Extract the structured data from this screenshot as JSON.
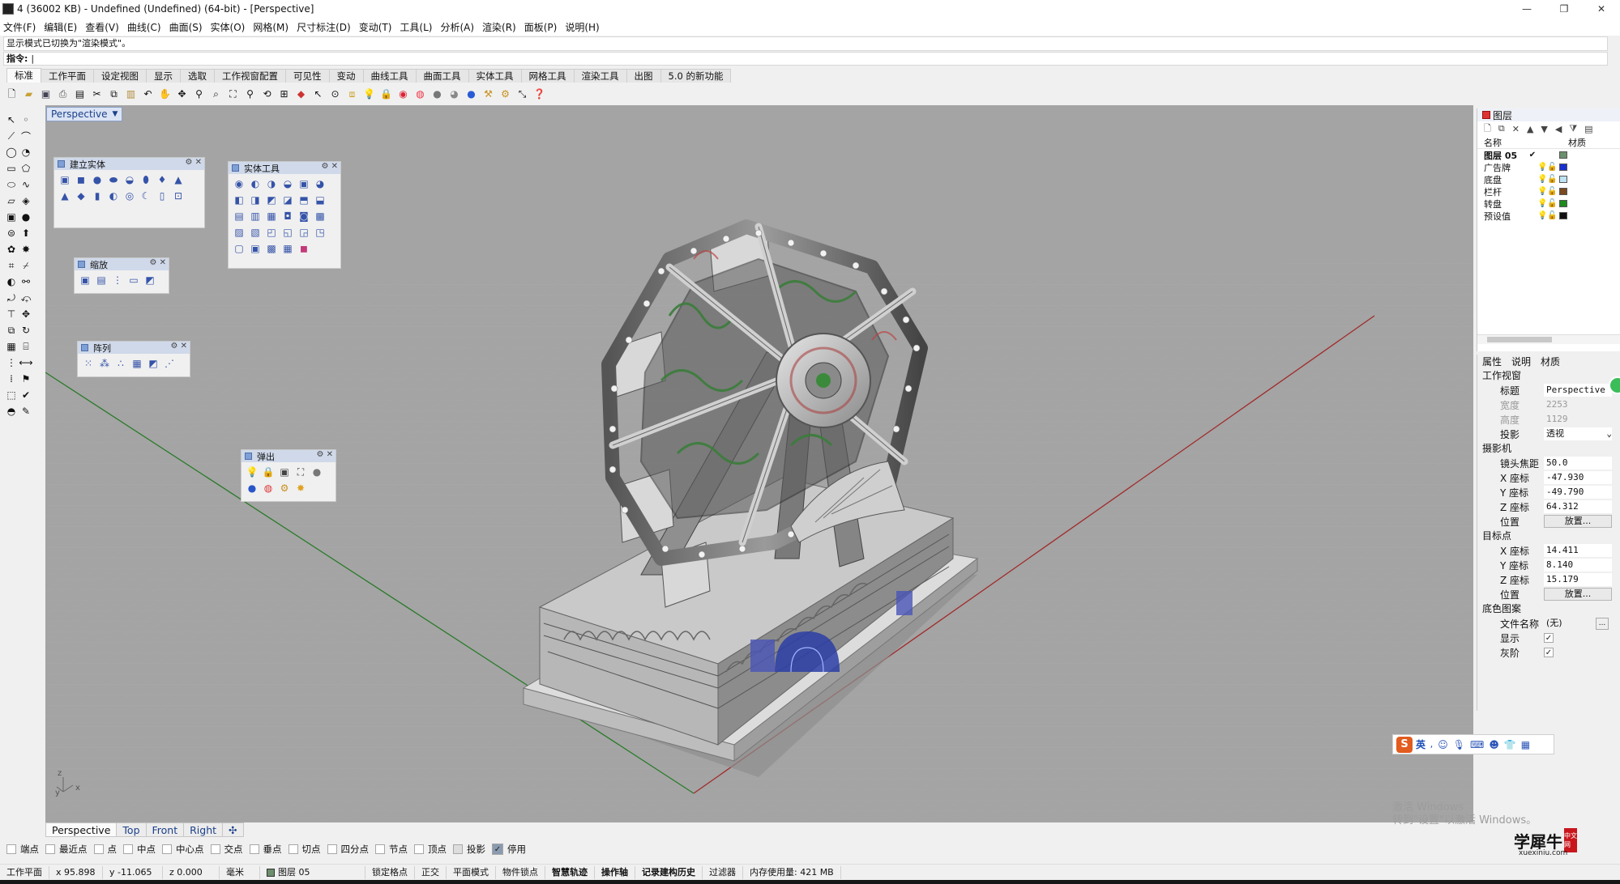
{
  "window": {
    "title": "4 (36002 KB) - Undefined (Undefined) (64-bit) - [Perspective]",
    "min": "—",
    "max": "❐",
    "close": "✕"
  },
  "menu": [
    "文件(F)",
    "编辑(E)",
    "查看(V)",
    "曲线(C)",
    "曲面(S)",
    "实体(O)",
    "网格(M)",
    "尺寸标注(D)",
    "变动(T)",
    "工具(L)",
    "分析(A)",
    "渲染(R)",
    "面板(P)",
    "说明(H)"
  ],
  "command": {
    "history": "显示模式已切换为\"渲染模式\"。",
    "prompt_label": "指令:",
    "prompt_value": "|"
  },
  "toolbar_tabs": [
    "标准",
    "工作平面",
    "设定视图",
    "显示",
    "选取",
    "工作视窗配置",
    "可见性",
    "变动",
    "曲线工具",
    "曲面工具",
    "实体工具",
    "网格工具",
    "渲染工具",
    "出图",
    "5.0 的新功能"
  ],
  "viewport": {
    "title": "Perspective",
    "axis_labels": {
      "x": "x",
      "y": "y",
      "z": "z"
    }
  },
  "palettes": {
    "solid_create": "建立实体",
    "solid_tools": "实体工具",
    "zoom": "缩放",
    "array": "阵列",
    "popup": "弹出"
  },
  "viewport_tabs": [
    "Perspective",
    "Top",
    "Front",
    "Right"
  ],
  "viewport_tab_add": "✣",
  "osnaps": [
    {
      "label": "端点",
      "checked": false
    },
    {
      "label": "最近点",
      "checked": false
    },
    {
      "label": "点",
      "checked": false
    },
    {
      "label": "中点",
      "checked": false
    },
    {
      "label": "中心点",
      "checked": false
    },
    {
      "label": "交点",
      "checked": false
    },
    {
      "label": "垂点",
      "checked": false
    },
    {
      "label": "切点",
      "checked": false
    },
    {
      "label": "四分点",
      "checked": false
    },
    {
      "label": "节点",
      "checked": false
    },
    {
      "label": "顶点",
      "checked": false
    },
    {
      "label": "投影",
      "checked": false
    },
    {
      "label": "停用",
      "checked": true
    }
  ],
  "status": {
    "cplane": "工作平面",
    "x": "x 95.898",
    "y": "y -11.065",
    "z": "z 0.000",
    "units": "毫米",
    "layer": "图层 05",
    "grid_snap": "锁定格点",
    "ortho": "正交",
    "planar": "平面模式",
    "osnap": "物件锁点",
    "smarttrack": "智慧轨迹",
    "gumball": "操作轴",
    "history": "记录建构历史",
    "filter": "过滤器",
    "memory": "内存使用量: 421 MB"
  },
  "layers": {
    "tab": "图层",
    "col_name": "名称",
    "col_material": "材质",
    "rows": [
      {
        "name": "图层 05",
        "current": "✔",
        "color": "#6c8f6c"
      },
      {
        "name": "广告牌",
        "current": "",
        "color": "#1a2fd0"
      },
      {
        "name": "底盘",
        "current": "",
        "color": "#bfe3f2"
      },
      {
        "name": "栏杆",
        "current": "",
        "color": "#7a4a22"
      },
      {
        "name": "转盘",
        "current": "",
        "color": "#1c8a1c"
      },
      {
        "name": "预设值",
        "current": "",
        "color": "#111111"
      }
    ]
  },
  "properties": {
    "tabs": [
      "属性",
      "说明",
      "材质"
    ],
    "section_viewport": "工作视窗",
    "title_label": "标题",
    "title_value": "Perspective",
    "width_label": "宽度",
    "width_value": "2253",
    "height_label": "高度",
    "height_value": "1129",
    "projection_label": "投影",
    "projection_value": "透视",
    "section_camera": "摄影机",
    "lens_label": "镜头焦距",
    "lens_value": "50.0",
    "cx_label": "X 座标",
    "cx_value": "-47.930",
    "cy_label": "Y 座标",
    "cy_value": "-49.790",
    "cz_label": "Z 座标",
    "cz_value": "64.312",
    "cpos_label": "位置",
    "cpos_button": "放置...",
    "section_target": "目标点",
    "tx_label": "X 座标",
    "tx_value": "14.411",
    "ty_label": "Y 座标",
    "ty_value": "8.140",
    "tz_label": "Z 座标",
    "tz_value": "15.179",
    "tpos_label": "位置",
    "tpos_button": "放置...",
    "section_wallpaper": "底色图案",
    "file_label": "文件名称",
    "file_value": "(无)",
    "show_label": "显示",
    "gray_label": "灰阶"
  },
  "ime": {
    "lang": "英"
  },
  "watermark": {
    "line1": "激活 Windows",
    "line2": "转到\"设置\"以激活 Windows。"
  },
  "logo": {
    "text": "学犀牛",
    "url": "xuexiniu.com",
    "badge": "中文网"
  }
}
